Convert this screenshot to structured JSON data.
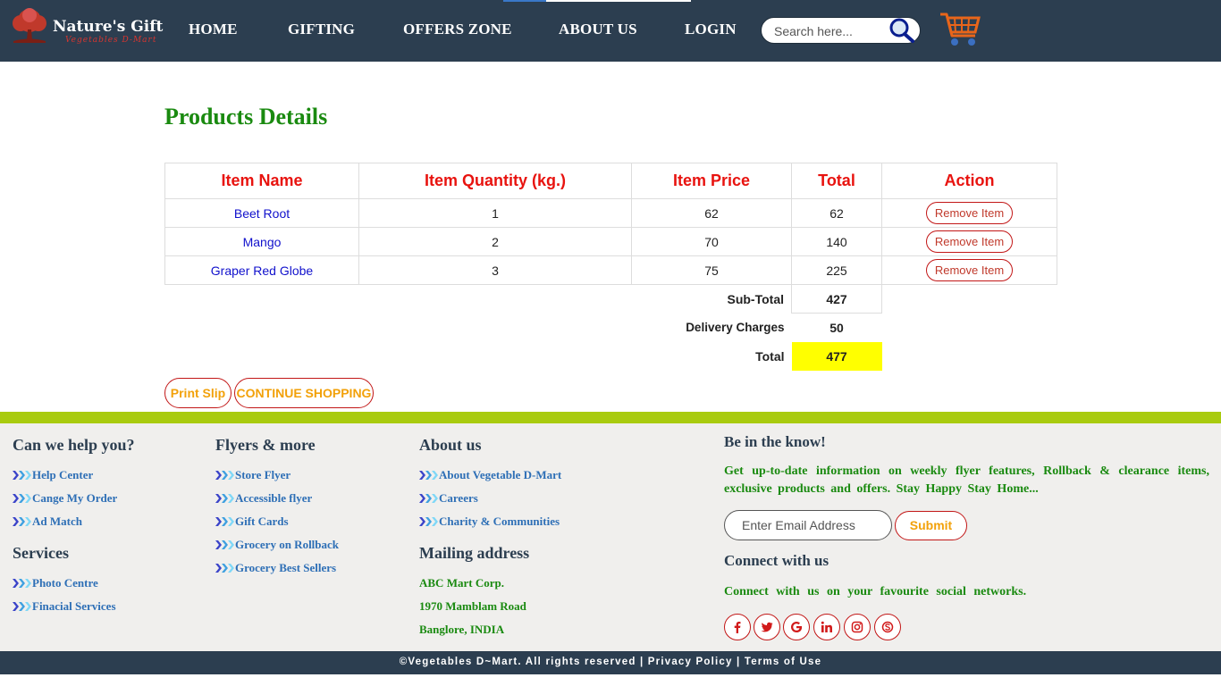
{
  "header": {
    "logo_title": "Nature's Gift",
    "logo_subtitle": "Vegetables D-Mart",
    "nav": [
      "HOME",
      "GIFTING",
      "OFFERS ZONE",
      "ABOUT US",
      "LOGIN"
    ],
    "search_placeholder": "Search here..."
  },
  "main": {
    "title": "Products Details",
    "columns": [
      "Item Name",
      "Item Quantity (kg.)",
      "Item Price",
      "Total",
      "Action"
    ],
    "rows": [
      {
        "name": "Beet Root",
        "qty": "1",
        "price": "62",
        "total": "62",
        "action": "Remove Item"
      },
      {
        "name": "Mango",
        "qty": "2",
        "price": "70",
        "total": "140",
        "action": "Remove Item"
      },
      {
        "name": "Graper Red Globe",
        "qty": "3",
        "price": "75",
        "total": "225",
        "action": "Remove Item"
      }
    ],
    "subtotal_label": "Sub-Total",
    "subtotal_value": "427",
    "delivery_label": "Delivery Charges",
    "delivery_value": "50",
    "grand_label": "Total",
    "grand_value": "477",
    "print_label": "Print Slip",
    "continue_label": "CONTINUE SHOPPING"
  },
  "footer": {
    "help": {
      "heading": "Can we help you?",
      "links": [
        "Help Center",
        "Cange My Order",
        "Ad Match"
      ]
    },
    "services": {
      "heading": "Services",
      "links": [
        "Photo Centre",
        "Finacial Services"
      ]
    },
    "flyers": {
      "heading": "Flyers & more",
      "links": [
        "Store Flyer",
        "Accessible flyer",
        "Gift Cards",
        "Grocery on Rollback",
        "Grocery Best Sellers"
      ]
    },
    "about": {
      "heading": "About us",
      "links": [
        "About Vegetable D-Mart",
        "Careers",
        "Charity & Communities"
      ]
    },
    "mailing": {
      "heading": "Mailing address",
      "lines": [
        "ABC Mart Corp.",
        "1970 Mamblam Road",
        "Banglore, INDIA"
      ]
    },
    "know": {
      "heading": "Be in the know!",
      "text": "Get up-to-date information on weekly flyer features, Rollback & clearance items, exclusive products and offers. Stay Happy Stay Home...",
      "email_placeholder": "Enter Email Address",
      "submit_label": "Submit"
    },
    "connect": {
      "heading": "Connect with us",
      "text": "Connect with us on your favourite social networks.",
      "icons": [
        "facebook-icon",
        "twitter-icon",
        "google-icon",
        "linkedin-icon",
        "instagram-icon",
        "skype-icon"
      ]
    },
    "copyright": "©Vegetables D~Mart. All rights reserved",
    "privacy": "Privacy Policy",
    "terms": "Terms of Use",
    "separator": "|"
  },
  "colors": {
    "header_bg": "#2c3e50",
    "title_green": "#1a8a10",
    "table_head_red": "#e8130f",
    "accent_orange": "#f2a10a",
    "footer_bar_green": "#a9cb0f",
    "highlight": "#ffff00"
  }
}
